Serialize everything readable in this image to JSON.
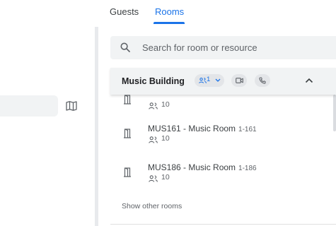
{
  "tabs": {
    "guests": "Guests",
    "rooms": "Rooms"
  },
  "search": {
    "placeholder": "Search for room or resource",
    "value": ""
  },
  "building": {
    "name": "Music Building",
    "capacity_filter": "1",
    "icons": [
      "people-icon",
      "video-icon",
      "phone-icon",
      "chevron-up-icon"
    ]
  },
  "rooms": [
    {
      "name": "",
      "code": "",
      "capacity": "10"
    },
    {
      "name": "MUS161 - Music Room",
      "code": "1-161",
      "capacity": "10"
    },
    {
      "name": "MUS186 - Music Room",
      "code": "1-186",
      "capacity": "10"
    }
  ],
  "show_other": "Show other rooms",
  "colors": {
    "accent": "#1a73e8",
    "panel": "#f1f3f4",
    "text": "#3c4043"
  }
}
